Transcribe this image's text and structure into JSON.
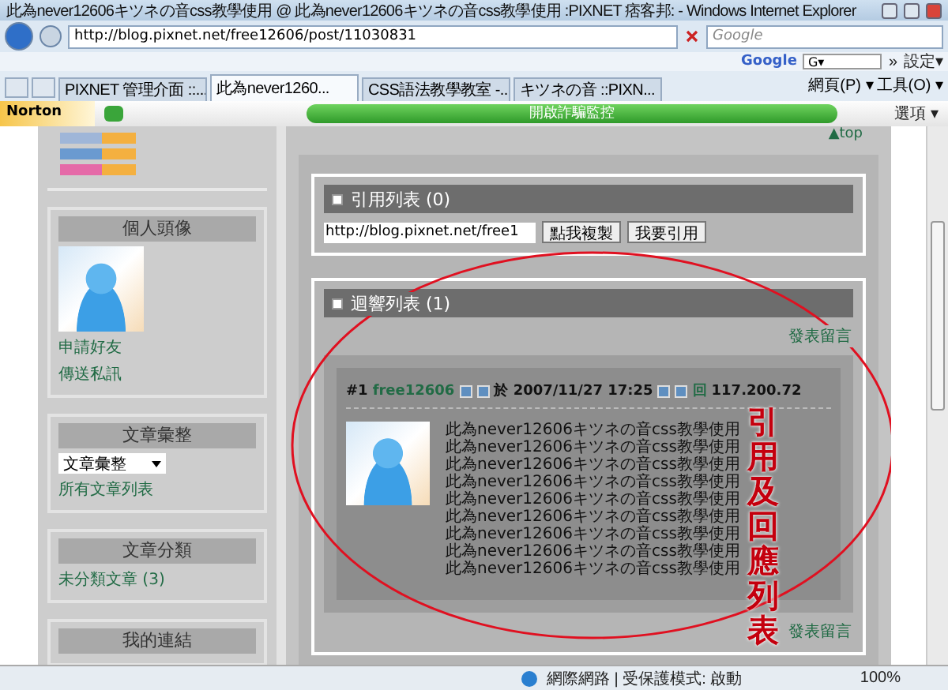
{
  "window": {
    "title": "此為never12606キツネの音css教學使用 @ 此為never12606キツネの音css教學使用 :PIXNET 痞客邦: - Windows Internet Explorer"
  },
  "address_bar": {
    "url": "http://blog.pixnet.net/free12606/post/11030831",
    "search_placeholder": "Google"
  },
  "google_toolbar": {
    "logo": "Google",
    "field": "G▾",
    "more": "»",
    "settings": "設定▾"
  },
  "tabs": [
    {
      "label": "PIXNET 管理介面 ::...",
      "selected": false
    },
    {
      "label": "此為never1260...",
      "selected": true
    },
    {
      "label": "CSS語法教學教室 -...",
      "selected": false
    },
    {
      "label": "キツネの音 ::PIXN...",
      "selected": false
    }
  ],
  "command_bar": {
    "page": "網頁(P) ▾",
    "tools": "工具(O) ▾"
  },
  "norton": {
    "logo": "Norton",
    "bar": "開啟詐騙監控",
    "options": "選項 ▾"
  },
  "sidebar": {
    "avatar_box": {
      "title": "個人頭像",
      "links": [
        "申請好友",
        "傳送私訊"
      ]
    },
    "archive_box": {
      "title": "文章彙整",
      "select": "文章彙整",
      "link": "所有文章列表"
    },
    "category_box": {
      "title": "文章分類",
      "link": "未分類文章 (3)"
    },
    "links_box": {
      "title": "我的連結"
    }
  },
  "main": {
    "top_link": "▲top",
    "trackback": {
      "title": "引用列表 (0)",
      "url": "http://blog.pixnet.net/free1",
      "buttons": [
        "點我複製",
        "我要引用"
      ]
    },
    "comments": {
      "title": "迴響列表 (1)",
      "post_link": "發表留言",
      "bottom_link": "發表留言",
      "items": [
        {
          "number": "#1",
          "author": "free12606",
          "date": "於 2007/11/27 17:25",
          "reply": "回",
          "ip": "117.200.72",
          "lines": [
            "此為never12606キツネの音css教學使用",
            "此為never12606キツネの音css教學使用",
            "此為never12606キツネの音css教學使用",
            "此為never12606キツネの音css教學使用",
            "此為never12606キツネの音css教學使用",
            "此為never12606キツネの音css教學使用",
            "此為never12606キツネの音css教學使用",
            "此為never12606キツネの音css教學使用",
            "此為never12606キツネの音css教學使用"
          ]
        }
      ]
    },
    "annotation": "引用及回應列表"
  },
  "status_bar": {
    "zone": "網際網路 | 受保護模式: 啟動",
    "zoom": "100%"
  }
}
